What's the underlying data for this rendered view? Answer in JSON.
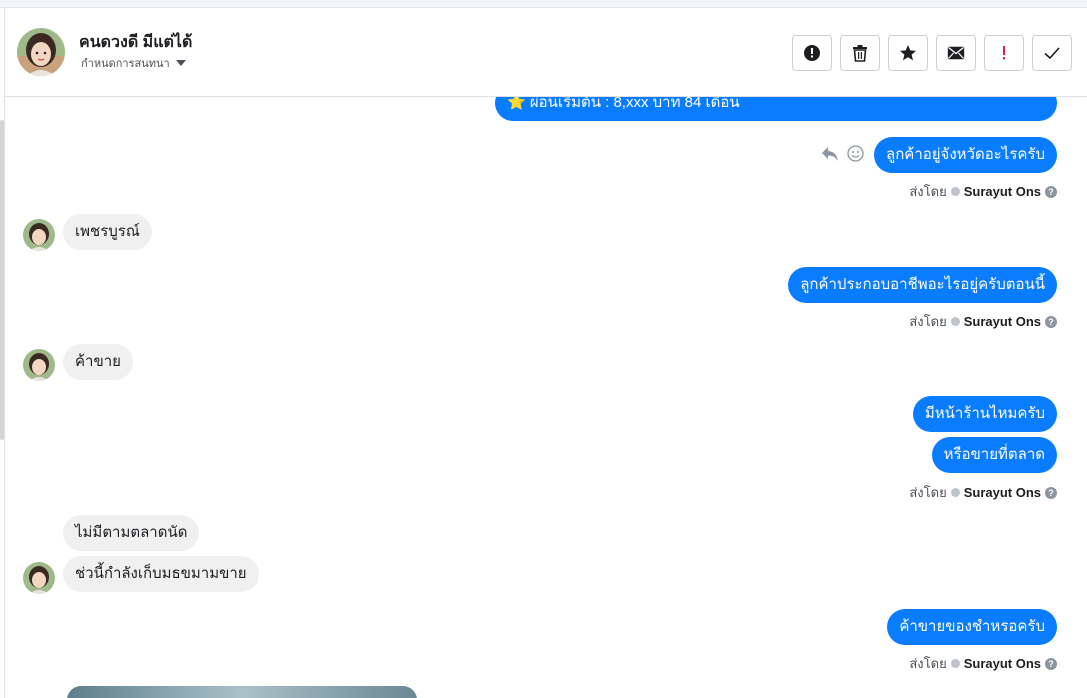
{
  "header": {
    "contact_name": "คนดวงดี มีแต่ได้",
    "assign_label": "กำหนดการสนทนา"
  },
  "toolbar": {
    "buttons": [
      {
        "icon": "exclamation-circle-icon"
      },
      {
        "icon": "trash-icon"
      },
      {
        "icon": "star-icon"
      },
      {
        "icon": "envelope-icon"
      },
      {
        "icon": "exclamation-mark-icon",
        "color": "#e41e3f"
      },
      {
        "icon": "checkmark-icon"
      }
    ]
  },
  "conversation": {
    "sender_prefix": "ส่งโดย",
    "sender_name": "Surayut Ons",
    "messages": [
      {
        "side": "out",
        "text": "⭐ ผ่อนเริ่มต้น : 8,xxx บาท 84 เดือน"
      },
      {
        "side": "out",
        "text": "ลูกค้าอยู่จังหวัดอะไรครับ"
      },
      {
        "side": "in",
        "text": "เพชรบูรณ์"
      },
      {
        "side": "out",
        "text": "ลูกค้าประกอบอาชีพอะไรอยู่ครับตอนนี้"
      },
      {
        "side": "in",
        "text": "ค้าขาย"
      },
      {
        "side": "out",
        "text": "มีหน้าร้านไหมครับ"
      },
      {
        "side": "out",
        "text": "หรือขายที่ตลาด"
      },
      {
        "side": "in",
        "text": "ไม่มีตามตลาดนัด"
      },
      {
        "side": "in",
        "text": "ช่วนี้กำลังเก็บมธขมามขาย"
      },
      {
        "side": "out",
        "text": "ค้าขายของชำหรอครับ"
      }
    ]
  },
  "colors": {
    "outgoing_bubble": "#0a7cff",
    "incoming_bubble": "#f0f0f0",
    "danger": "#e41e3f"
  }
}
